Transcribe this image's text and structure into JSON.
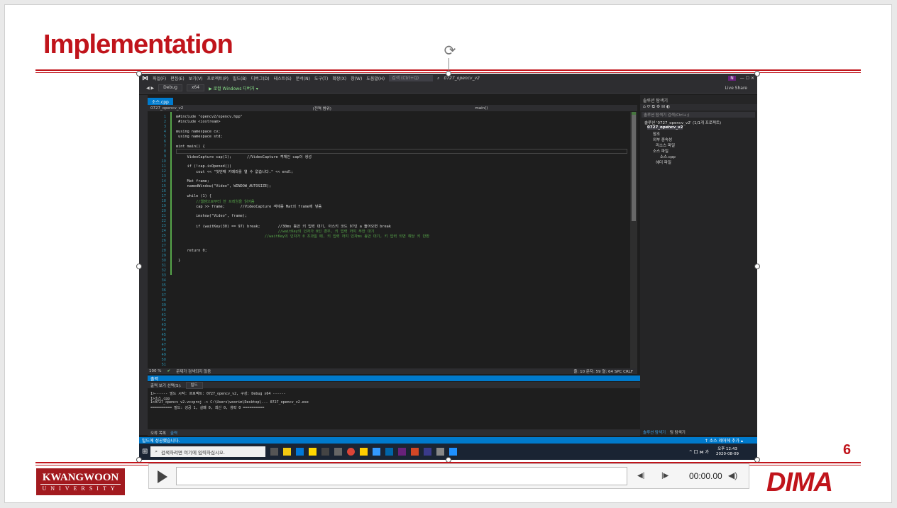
{
  "slide": {
    "title": "Implementation",
    "page_number": "6"
  },
  "vs": {
    "menu": [
      "파일(F)",
      "편집(E)",
      "보기(V)",
      "프로젝트(P)",
      "빌드(B)",
      "디버그(D)",
      "테스트(S)",
      "분석(N)",
      "도구(T)",
      "확장(X)",
      "창(W)",
      "도움말(H)"
    ],
    "search_placeholder": "검색 (Ctrl+Q)",
    "solution_name": "0727_opencv_v2",
    "user_badge": "N",
    "toolbar": {
      "config": "Debug",
      "platform": "x64",
      "run_label": "▶ 로컬 Windows 디버거 ▾",
      "live_share": "Live Share"
    },
    "editor": {
      "tab": "소스.cpp",
      "nav_project": "0727_opencv_v2",
      "nav_scope": "(전역 범위)",
      "nav_func": "main()",
      "line_numbers": [
        "1",
        "2",
        "3",
        "4",
        "5",
        "6",
        "7",
        "8",
        "9",
        "10",
        "11",
        "12",
        "13",
        "14",
        "15",
        "16",
        "17",
        "18",
        "19",
        "20",
        "21",
        "22",
        "23",
        "24",
        "25",
        "26",
        "27",
        "28",
        "29",
        "30",
        "31",
        "32",
        "33",
        "34",
        "35",
        "36",
        "37",
        "38",
        "39",
        "40",
        "41",
        "42",
        "43",
        "44",
        "45",
        "46",
        "47",
        "48",
        "49",
        "50",
        "51"
      ],
      "code_lines": [
        {
          "t": "⊟#include \"opencv2/opencv.hpp\"",
          "c": false
        },
        {
          "t": " #include <iostream>",
          "c": false
        },
        {
          "t": "",
          "c": false
        },
        {
          "t": "⊟using namespace cv;",
          "c": false
        },
        {
          "t": " using namespace std;",
          "c": false
        },
        {
          "t": "",
          "c": false
        },
        {
          "t": "⊟int main() {",
          "c": false
        },
        {
          "t": "",
          "c": false
        },
        {
          "t": "     VideoCapture cap(1);       //VideoCapture 객체인 cap이 생성",
          "c": false
        },
        {
          "t": "",
          "c": false
        },
        {
          "t": "     if (!cap.isOpened())",
          "c": false
        },
        {
          "t": "         cout << \"첫번째 카메라를 열 수 없습니다.\" << endl;",
          "c": false
        },
        {
          "t": "",
          "c": false
        },
        {
          "t": "     Mat frame;",
          "c": false
        },
        {
          "t": "     namedWindow(\"Video\", WINDOW_AUTOSIZE);",
          "c": false
        },
        {
          "t": "",
          "c": false
        },
        {
          "t": "     while (1) {",
          "c": false
        },
        {
          "t": "         //웹캠으로부터 한 프레임을 읽어옴",
          "c": true
        },
        {
          "t": "         cap >> frame;       //VideoCapture 객체를 Mat의 frame에 넣음",
          "c": false
        },
        {
          "t": "",
          "c": false
        },
        {
          "t": "         imshow(\"Video\", frame);",
          "c": false
        },
        {
          "t": "",
          "c": false
        },
        {
          "t": "         if (waitKey(30) == 97) break;        //30ms 동안 키 입력 대기, 아스키 코드 97인 a 들어오면 break",
          "c": false
        },
        {
          "t": "                                              //waitKey의 인자가 0인 경우, 키 입력 까지 무한 대기",
          "c": true
        },
        {
          "t": "                                        //waitKey의 인자가 0 초과일 때, 키 입력 까지 인자ms 동안 대기, 키 입력 되면 해당 키 반환",
          "c": true
        },
        {
          "t": "",
          "c": false
        },
        {
          "t": "",
          "c": false
        },
        {
          "t": "     return 0;",
          "c": false
        },
        {
          "t": "",
          "c": false
        },
        {
          "t": " }",
          "c": false
        }
      ],
      "zoom": "100 %",
      "issues": "문제가 검색되지 않음",
      "cursor": "줄: 10   문자: 59   열: 64   SPC   CRLF"
    },
    "output": {
      "header": "출력",
      "source_label": "출력 보기 선택(S):",
      "source_value": "빌드",
      "lines": [
        "1>------ 빌드 시작: 프로젝트: 0727_opencv_v2, 구성: Debug x64 ------",
        "1>소스.cpp",
        "1>0727_opencv_v2.vcxproj -> C:\\Users\\woorim\\Desktop\\... 0727_opencv_v2.exe",
        "========== 빌드: 성공 1, 실패 0, 최신 0, 생략 0 =========="
      ],
      "tabs": [
        "오류 목록",
        "출력"
      ]
    },
    "solution_explorer": {
      "title": "솔루션 탐색기",
      "search_placeholder": "솔루션 탐색기 검색(Ctrl+;)",
      "items": [
        "솔루션 '0727_opencv_v2' (1/1개 프로젝트)",
        "0727_opencv_v2",
        "참조",
        "외부 종속성",
        "리소스 파일",
        "소스 파일",
        "소스.cpp",
        "헤더 파일"
      ],
      "tabs": [
        "솔루션 탐색기",
        "팀 탐색기"
      ]
    },
    "status": {
      "left": "빌드에 성공했습니다.",
      "right": "↑ 소스 제어에 추가 ▴"
    },
    "taskbar": {
      "search_placeholder": "검색하려면 여기에 입력하십시오.",
      "time": "오후 12:43",
      "date": "2020-08-09",
      "tray": "^ 口 ⋈ 가"
    }
  },
  "player": {
    "time": "00:00.00"
  },
  "logos": {
    "kwangwoon_line1": "KWANGWOON",
    "kwangwoon_line2": "UNIVERSITY",
    "dima": "DIMA"
  },
  "colors": {
    "accent_red": "#c0141b",
    "vs_blue": "#007acc",
    "vs_bg": "#1e1e1e"
  }
}
